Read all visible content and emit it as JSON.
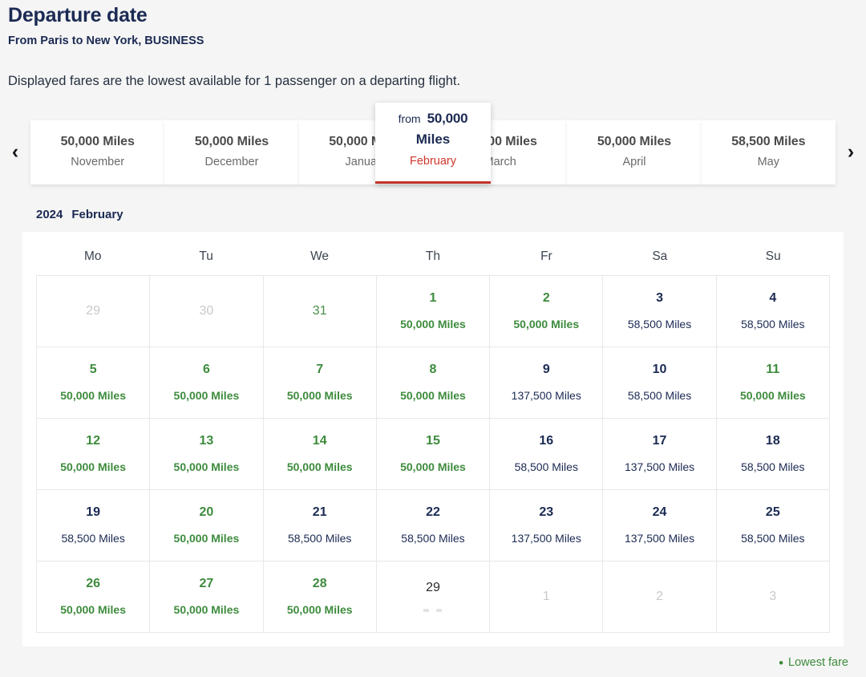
{
  "header": {
    "title": "Departure date",
    "route": "From Paris to New York, BUSINESS",
    "note": "Displayed fares are the lowest available for 1 passenger on a departing flight."
  },
  "carousel": {
    "prev_icon": "chevron-left-icon",
    "next_icon": "chevron-right-icon",
    "prev_glyph": "‹",
    "next_glyph": "›",
    "months": [
      {
        "name": "November",
        "miles": "50,000 Miles",
        "active": false
      },
      {
        "name": "December",
        "miles": "50,000 Miles",
        "active": false
      },
      {
        "name": "January",
        "miles": "50,000 Miles",
        "active": false
      },
      {
        "name": "March",
        "miles": "50,000 Miles",
        "active": false
      },
      {
        "name": "April",
        "miles": "50,000 Miles",
        "active": false
      },
      {
        "name": "May",
        "miles": "58,500 Miles",
        "active": false
      }
    ],
    "active_month": {
      "from_label": "from",
      "amount": "50,000",
      "unit": "Miles",
      "name": "February",
      "accent_color": "#c03428",
      "name_color": "#d0352a"
    }
  },
  "calendar": {
    "year": "2024",
    "month": "February",
    "weekdays": [
      "Mo",
      "Tu",
      "We",
      "Th",
      "Fr",
      "Sa",
      "Su"
    ],
    "weeks": [
      [
        {
          "day": "29",
          "fare": "",
          "state": "muted"
        },
        {
          "day": "30",
          "fare": "",
          "state": "muted"
        },
        {
          "day": "31",
          "fare": "",
          "state": "green-plain"
        },
        {
          "day": "1",
          "fare": "50,000 Miles",
          "state": "lowest"
        },
        {
          "day": "2",
          "fare": "50,000 Miles",
          "state": "lowest"
        },
        {
          "day": "3",
          "fare": "58,500 Miles",
          "state": "normal"
        },
        {
          "day": "4",
          "fare": "58,500 Miles",
          "state": "normal"
        }
      ],
      [
        {
          "day": "5",
          "fare": "50,000 Miles",
          "state": "lowest"
        },
        {
          "day": "6",
          "fare": "50,000 Miles",
          "state": "lowest"
        },
        {
          "day": "7",
          "fare": "50,000 Miles",
          "state": "lowest"
        },
        {
          "day": "8",
          "fare": "50,000 Miles",
          "state": "lowest"
        },
        {
          "day": "9",
          "fare": "137,500 Miles",
          "state": "normal"
        },
        {
          "day": "10",
          "fare": "58,500 Miles",
          "state": "normal"
        },
        {
          "day": "11",
          "fare": "50,000 Miles",
          "state": "lowest"
        }
      ],
      [
        {
          "day": "12",
          "fare": "50,000 Miles",
          "state": "lowest"
        },
        {
          "day": "13",
          "fare": "50,000 Miles",
          "state": "lowest"
        },
        {
          "day": "14",
          "fare": "50,000 Miles",
          "state": "lowest"
        },
        {
          "day": "15",
          "fare": "50,000 Miles",
          "state": "lowest"
        },
        {
          "day": "16",
          "fare": "58,500 Miles",
          "state": "normal"
        },
        {
          "day": "17",
          "fare": "137,500 Miles",
          "state": "normal"
        },
        {
          "day": "18",
          "fare": "58,500 Miles",
          "state": "normal"
        }
      ],
      [
        {
          "day": "19",
          "fare": "58,500 Miles",
          "state": "normal"
        },
        {
          "day": "20",
          "fare": "50,000 Miles",
          "state": "lowest"
        },
        {
          "day": "21",
          "fare": "58,500 Miles",
          "state": "normal"
        },
        {
          "day": "22",
          "fare": "58,500 Miles",
          "state": "normal"
        },
        {
          "day": "23",
          "fare": "137,500 Miles",
          "state": "normal"
        },
        {
          "day": "24",
          "fare": "137,500 Miles",
          "state": "normal"
        },
        {
          "day": "25",
          "fare": "58,500 Miles",
          "state": "normal"
        }
      ],
      [
        {
          "day": "26",
          "fare": "50,000 Miles",
          "state": "lowest"
        },
        {
          "day": "27",
          "fare": "50,000 Miles",
          "state": "lowest"
        },
        {
          "day": "28",
          "fare": "50,000 Miles",
          "state": "lowest"
        },
        {
          "day": "29",
          "fare": "",
          "state": "loading"
        },
        {
          "day": "1",
          "fare": "",
          "state": "muted"
        },
        {
          "day": "2",
          "fare": "",
          "state": "muted"
        },
        {
          "day": "3",
          "fare": "",
          "state": "muted"
        }
      ]
    ]
  },
  "legend": {
    "dot": "•",
    "label": "Lowest fare",
    "color": "#3d8b3d"
  }
}
